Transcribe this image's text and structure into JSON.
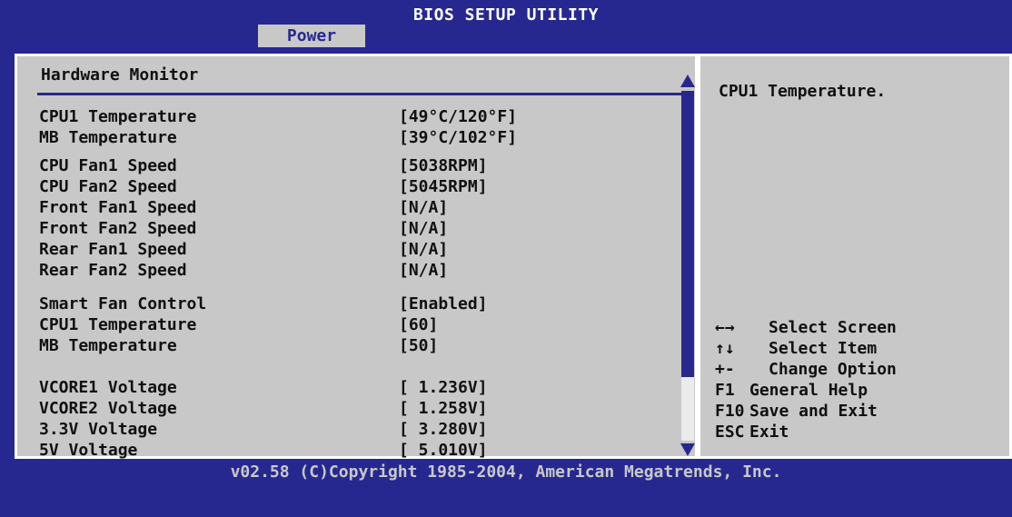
{
  "window": {
    "title": "BIOS SETUP UTILITY"
  },
  "tabs": [
    {
      "label": "Power",
      "selected": true
    }
  ],
  "section": {
    "title": "Hardware Monitor"
  },
  "rows": [
    {
      "label": "CPU1 Temperature",
      "value": "[49°C/120°F]"
    },
    {
      "label": "MB Temperature",
      "value": "[39°C/102°F]"
    },
    {
      "label": "CPU Fan1 Speed",
      "value": "[5038RPM]"
    },
    {
      "label": "CPU Fan2 Speed",
      "value": "[5045RPM]"
    },
    {
      "label": "Front Fan1 Speed",
      "value": "[N/A]"
    },
    {
      "label": "Front Fan2 Speed",
      "value": "[N/A]"
    },
    {
      "label": "Rear Fan1 Speed",
      "value": "[N/A]"
    },
    {
      "label": "Rear Fan2 Speed",
      "value": "[N/A]"
    },
    {
      "label": "Smart Fan Control",
      "value": "[Enabled]"
    },
    {
      "label": "CPU1 Temperature",
      "value": "[60]"
    },
    {
      "label": "MB Temperature",
      "value": "[50]"
    },
    {
      "label": "VCORE1 Voltage",
      "value": "[ 1.236V]"
    },
    {
      "label": "VCORE2 Voltage",
      "value": "[ 1.258V]"
    },
    {
      "label": "3.3V Voltage",
      "value": "[ 3.280V]"
    },
    {
      "label": "5V Voltage",
      "value": "[ 5.010V]"
    }
  ],
  "help": {
    "text": "CPU1 Temperature.",
    "keys": [
      {
        "key": "←→",
        "desc": "Select Screen"
      },
      {
        "key": "↑↓",
        "desc": "Select Item"
      },
      {
        "key": "+-",
        "desc": "Change Option"
      },
      {
        "key": "F1",
        "desc": "General Help"
      },
      {
        "key": "F10",
        "desc": "Save and Exit"
      },
      {
        "key": "ESC",
        "desc": "Exit"
      }
    ]
  },
  "footer": "v02.58 (C)Copyright 1985-2004, American Megatrends, Inc.",
  "colors": {
    "background": "#27288f",
    "panel": "#c8c8c8",
    "text": "#111111",
    "border": "#ffffff"
  }
}
